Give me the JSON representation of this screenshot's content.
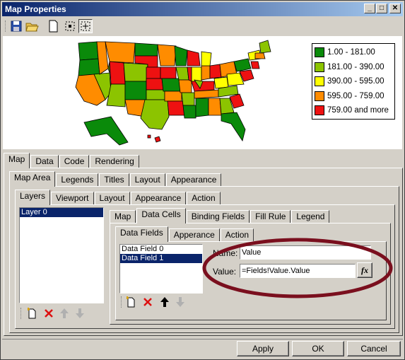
{
  "window": {
    "title": "Map Properties"
  },
  "title_buttons": {
    "minimize": "_",
    "maximize": "□",
    "close": "✕"
  },
  "toolbar": {
    "icons": [
      "save-icon",
      "open-folder-icon",
      "new-page-icon",
      "select-icon",
      "zoom-extent-icon"
    ]
  },
  "legend": [
    {
      "label": "1.00 - 181.00",
      "color": "#0a8a0a"
    },
    {
      "label": "181.00 - 390.00",
      "color": "#8cc400"
    },
    {
      "label": "390.00 - 595.00",
      "color": "#ffff00"
    },
    {
      "label": "595.00 - 759.00",
      "color": "#ff8c00"
    },
    {
      "label": "759.00 and more",
      "color": "#ee1111"
    }
  ],
  "main_tabs": [
    "Map",
    "Data",
    "Code",
    "Rendering"
  ],
  "map_tabs": [
    "Map Area",
    "Legends",
    "Titles",
    "Layout",
    "Appearance"
  ],
  "area_tabs": [
    "Layers",
    "Viewport",
    "Layout",
    "Appearance",
    "Action"
  ],
  "layers": {
    "items": [
      "Layer 0"
    ]
  },
  "layer_tabs": [
    "Map",
    "Data Cells",
    "Binding Fields",
    "Fill Rule",
    "Legend"
  ],
  "cell_tabs": [
    "Data Fields",
    "Apperance",
    "Action"
  ],
  "data_fields": {
    "items": [
      "Data Field 0",
      "Data Field 1"
    ]
  },
  "form": {
    "name_label": "Name:",
    "name_value": "Value",
    "value_label": "Value:",
    "value_value": "=Fields!Value.Value",
    "fx_label": "fx"
  },
  "footer": {
    "apply": "Apply",
    "ok": "OK",
    "cancel": "Cancel"
  },
  "colors": {
    "accent_ellipse": "#7a0f1e",
    "selection": "#0a246a"
  }
}
